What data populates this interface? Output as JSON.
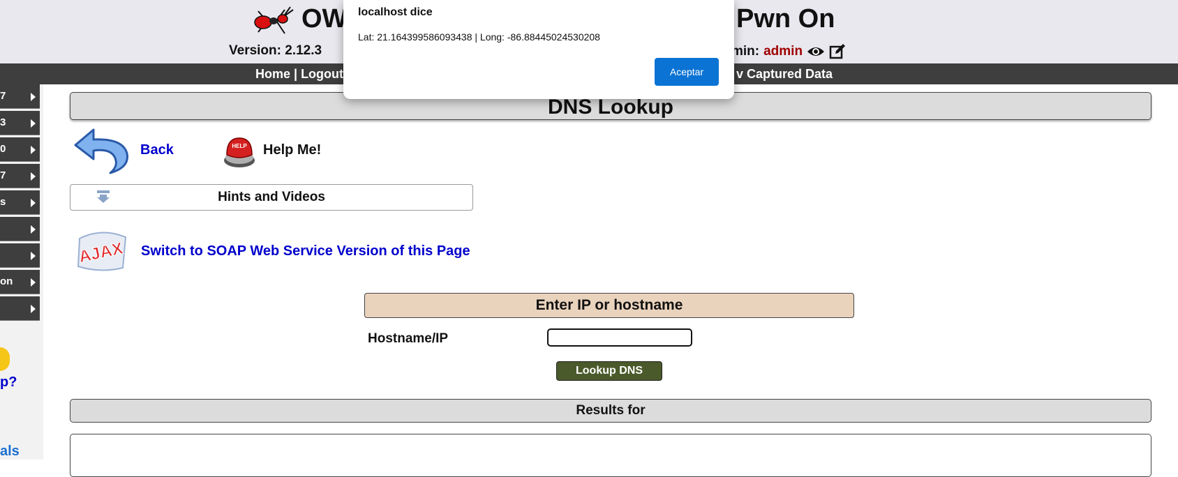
{
  "header": {
    "title_left": "OWA",
    "title_right": "Pwn On",
    "version": "Version: 2.12.3",
    "logged_in_label": "min:",
    "logged_in_user": "admin",
    "icons": [
      "ant-logo-icon",
      "eye-icon",
      "edit-icon"
    ]
  },
  "nav": {
    "home": "Home",
    "sep1": " | ",
    "logout": "Logout",
    "sep2": " |",
    "captured": "v Captured Data"
  },
  "sidebar": {
    "items": [
      {
        "label": "7"
      },
      {
        "label": "3"
      },
      {
        "label": "0"
      },
      {
        "label": "7"
      },
      {
        "label": "s"
      },
      {
        "label": ""
      },
      {
        "label": ""
      },
      {
        "label": "on"
      },
      {
        "label": ""
      }
    ],
    "help_text": "p?",
    "tutorials_text": "als"
  },
  "main": {
    "page_title": "DNS Lookup",
    "back_label": "Back",
    "help_label": "Help Me!",
    "hints_label": "Hints and Videos",
    "soap_link": "Switch to SOAP Web Service Version of this Page",
    "form_header": "Enter IP or hostname",
    "hostname_label": "Hostname/IP",
    "hostname_value": "",
    "lookup_button": "Lookup DNS",
    "results_label": "Results for"
  },
  "dialog": {
    "title": "localhost dice",
    "message": "Lat: 21.164399586093438 | Long: -86.88445024530208",
    "ok_button": "Aceptar"
  },
  "colors": {
    "header_bg": "#e8e8ee",
    "nav_bg": "#3e3e3e",
    "link_blue": "#0000cc",
    "user_red": "#a00000",
    "form_header_bg": "#ead3bd",
    "lookup_button_bg": "#4a5a2a",
    "dialog_button_bg": "#0b73d4"
  }
}
